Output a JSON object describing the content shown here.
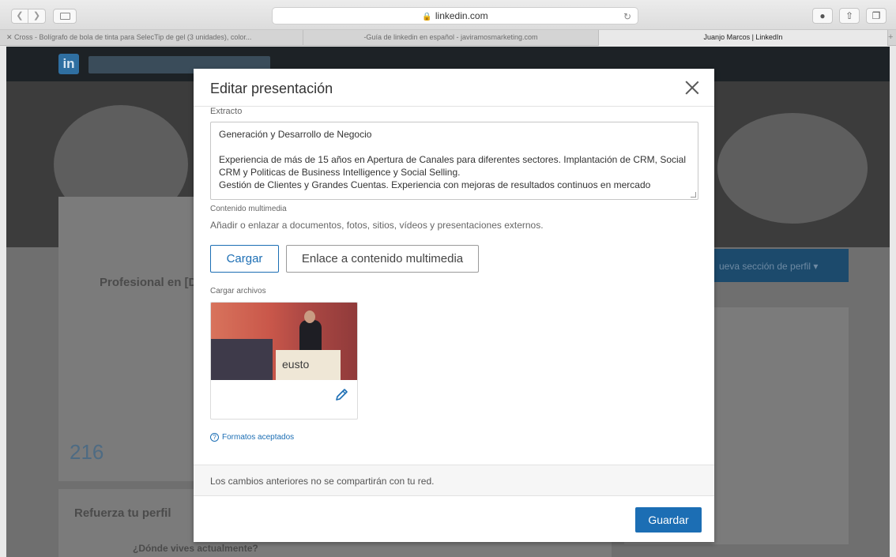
{
  "browser": {
    "address": "linkedin.com",
    "tabs": [
      "Cross - Bolígrafo de bola de tinta para SelecTip de gel (3 unidades), color...",
      "-Guía de linkedin en español - javiramosmarketing.com",
      "Juanjo Marcos | LinkedIn"
    ]
  },
  "background": {
    "logo": "in",
    "professional": "Profesional en [De",
    "count": "216",
    "reinforce": "Refuerza tu perfil",
    "question": "¿Dónde vives actualmente?",
    "add_section": "ueva sección de perfil ▾"
  },
  "modal": {
    "title": "Editar presentación",
    "extract_label": "Extracto",
    "extract_lines": [
      "Generación y Desarrollo de Negocio",
      "",
      "Experiencia de más de 15 años en Apertura de Canales para diferentes sectores. Implantación de CRM, Social CRM y Politicas de Business Intelligence y Social Selling.",
      "Gestión de Clientes y Grandes Cuentas. Experiencia con mejoras de resultados continuos en mercado"
    ],
    "multimedia_label": "Contenido multimedia",
    "multimedia_help": "Añadir o enlazar a documentos, fotos, sitios, vídeos y presentaciones externos.",
    "upload_button": "Cargar",
    "link_button": "Enlace a contenido multimedia",
    "upload_files_label": "Cargar archivos",
    "thumb_logo_text": "eusto",
    "formats_link": "Formatos aceptados",
    "notice": "Los cambios anteriores no se compartirán con tu red.",
    "save_button": "Guardar"
  }
}
